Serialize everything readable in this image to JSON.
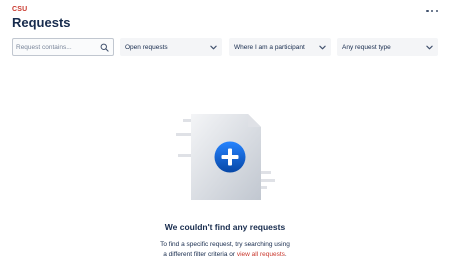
{
  "header": {
    "org_name": "CSU",
    "title": "Requests",
    "more_icon": "more-horizontal-icon"
  },
  "filters": {
    "search_placeholder": "Request contains...",
    "search_value": "",
    "status": "Open requests",
    "participation": "Where I am a participant",
    "request_type": "Any request type"
  },
  "empty_state": {
    "title": "We couldn't find any requests",
    "message_line1": "To find a specific request, try searching using",
    "message_line2_prefix": "a different filter criteria or ",
    "link_text": "view all requests",
    "message_line2_suffix": ".",
    "illustration_icon": "plus-document-icon"
  },
  "colors": {
    "accent": "#c9372c",
    "primary_blue": "#0c66e4",
    "text": "#172b4d"
  }
}
